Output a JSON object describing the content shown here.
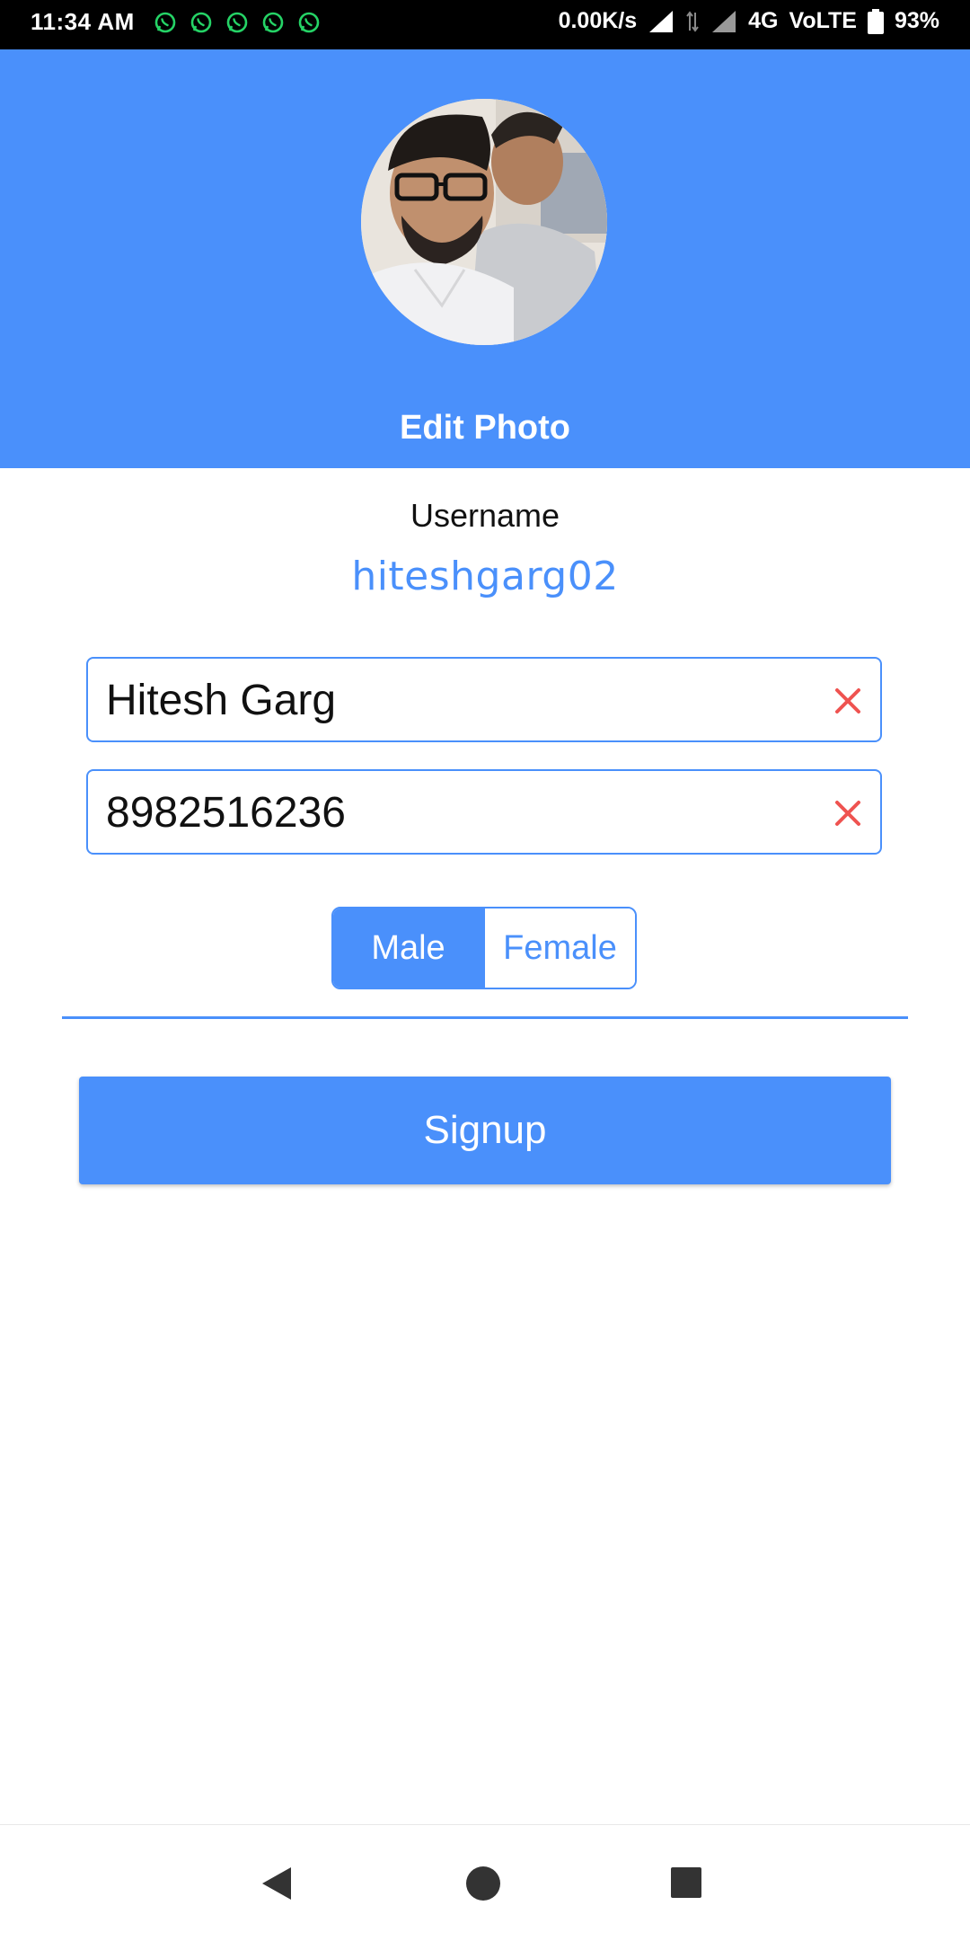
{
  "status_bar": {
    "time": "11:34 AM",
    "notification_icons": [
      "whatsapp-icon",
      "whatsapp-icon",
      "whatsapp-icon",
      "whatsapp-icon",
      "whatsapp-icon"
    ],
    "net_speed": "0.00K/s",
    "network": "4G",
    "volte": "VoLTE",
    "battery": "93%"
  },
  "header": {
    "background_color": "#4a90fb",
    "avatar": "profile-photo",
    "edit_photo_label": "Edit Photo"
  },
  "username": {
    "label": "Username",
    "value": "hiteshgarg02"
  },
  "form": {
    "name_value": "Hitesh Garg",
    "phone_value": "8982516236",
    "clear_icon": "close-icon",
    "clear_color": "#ef5350"
  },
  "gender": {
    "options": [
      "Male",
      "Female"
    ],
    "selected": "Male"
  },
  "signup_label": "Signup",
  "nav": {
    "back_icon": "back-triangle-icon",
    "home_icon": "home-circle-icon",
    "recents_icon": "recents-square-icon"
  }
}
